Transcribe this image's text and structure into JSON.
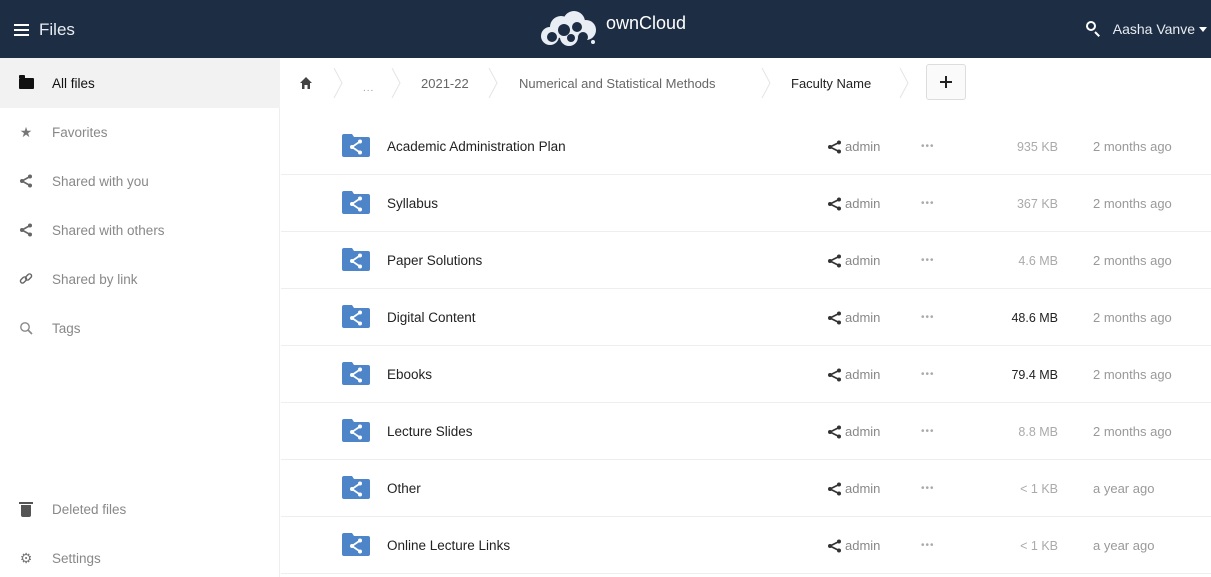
{
  "header": {
    "app_name": "Files",
    "brand": "ownCloud",
    "user_name": "Aasha Vanve"
  },
  "sidebar": {
    "items": [
      {
        "label": "All files",
        "icon": "folder-icon"
      },
      {
        "label": "Favorites",
        "icon": "star-icon"
      },
      {
        "label": "Shared with you",
        "icon": "share-icon"
      },
      {
        "label": "Shared with others",
        "icon": "share-icon"
      },
      {
        "label": "Shared by link",
        "icon": "link-icon"
      },
      {
        "label": "Tags",
        "icon": "search-icon"
      }
    ],
    "bottom": [
      {
        "label": "Deleted files",
        "icon": "trash-icon"
      },
      {
        "label": "Settings",
        "icon": "gear-icon"
      }
    ]
  },
  "breadcrumb": {
    "ellipsis": "...",
    "items": [
      "2021-22",
      "Numerical and Statistical Methods",
      "Faculty Name"
    ]
  },
  "files": [
    {
      "name": "Academic Administration Plan",
      "owner": "admin",
      "size": "935 KB",
      "modified": "2 months ago",
      "size_emphasis": false
    },
    {
      "name": "Syllabus",
      "owner": "admin",
      "size": "367 KB",
      "modified": "2 months ago",
      "size_emphasis": false
    },
    {
      "name": "Paper Solutions",
      "owner": "admin",
      "size": "4.6 MB",
      "modified": "2 months ago",
      "size_emphasis": false
    },
    {
      "name": "Digital Content",
      "owner": "admin",
      "size": "48.6 MB",
      "modified": "2 months ago",
      "size_emphasis": true
    },
    {
      "name": "Ebooks",
      "owner": "admin",
      "size": "79.4 MB",
      "modified": "2 months ago",
      "size_emphasis": true
    },
    {
      "name": "Lecture Slides",
      "owner": "admin",
      "size": "8.8 MB",
      "modified": "2 months ago",
      "size_emphasis": false
    },
    {
      "name": "Other",
      "owner": "admin",
      "size": "< 1 KB",
      "modified": "a year ago",
      "size_emphasis": false
    },
    {
      "name": "Online Lecture Links",
      "owner": "admin",
      "size": "< 1 KB",
      "modified": "a year ago",
      "size_emphasis": false
    }
  ],
  "more_glyph": "•••",
  "colors": {
    "header_bg": "#1d2d44",
    "folder_blue": "#4e85c8",
    "active_row": "#f2f2f2"
  }
}
